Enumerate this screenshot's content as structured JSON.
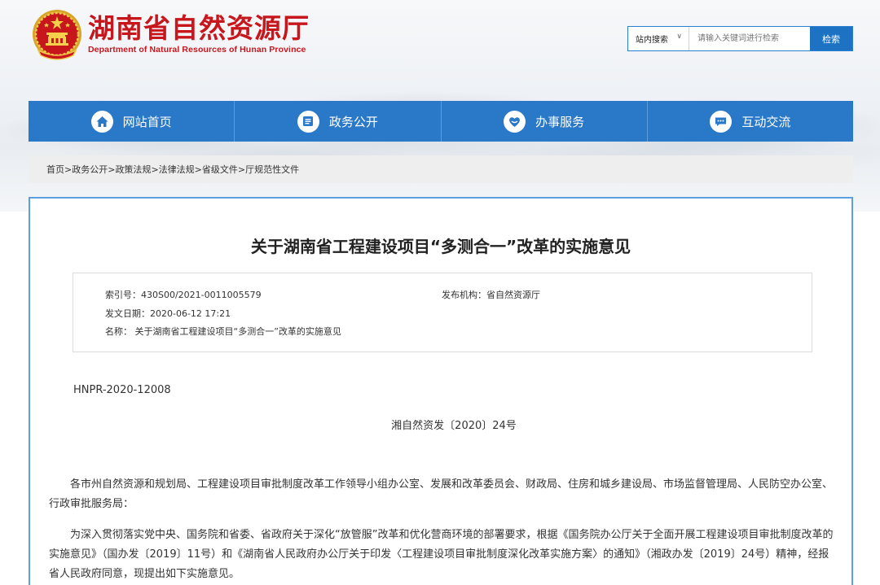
{
  "header": {
    "title_cn": "湖南省自然资源厅",
    "title_en": "Department of Natural Resources of Hunan Province",
    "logo_icon": "national-emblem-icon",
    "brand_color": "#c8161d"
  },
  "search": {
    "scope_label": "站内搜索",
    "scope_caret": "∨",
    "placeholder": "请输入关键词进行检索",
    "button_label": "检索"
  },
  "nav": {
    "items": [
      {
        "label": "网站首页",
        "icon": "home-icon"
      },
      {
        "label": "政务公开",
        "icon": "document-list-icon"
      },
      {
        "label": "办事服务",
        "icon": "service-heart-icon"
      },
      {
        "label": "互动交流",
        "icon": "chat-bubble-icon"
      }
    ],
    "color": "#2a78c8"
  },
  "breadcrumb": {
    "items": [
      "首页",
      "政务公开",
      "政策法规",
      "法律法规",
      "省级文件",
      "厅规范性文件"
    ],
    "separator": ">"
  },
  "article": {
    "title": "关于湖南省工程建设项目“多测合一”改革的实施意见",
    "meta": {
      "index_label": "索引号：",
      "index_value": "430S00/2021-0011005579",
      "publisher_label": "发布机构：",
      "publisher_value": "省自然资源厅",
      "date_label": "发文日期：",
      "date_value": "2020-06-12 17:21",
      "name_label": "名称：",
      "name_value": "关于湖南省工程建设项目“多测合一”改革的实施意见"
    },
    "doc_code": "HNPR-2020-12008",
    "file_number": "湘自然资发〔2020〕24号",
    "paragraphs": [
      "各市州自然资源和规划局、工程建设项目审批制度改革工作领导小组办公室、发展和改革委员会、财政局、住房和城乡建设局、市场监督管理局、人民防空办公室、行政审批服务局：",
      "为深入贯彻落实党中央、国务院和省委、省政府关于深化“放管服”改革和优化营商环境的部署要求，根据《国务院办公厅关于全面开展工程建设项目审批制度改革的实施意见》（国办发〔2019〕11号）和《湖南省人民政府办公厅关于印发〈工程建设项目审批制度深化改革实施方案〉的通知》（湘政办发〔2019〕24号）精神，经报省人民政府同意，现提出如下实施意见。"
    ]
  }
}
